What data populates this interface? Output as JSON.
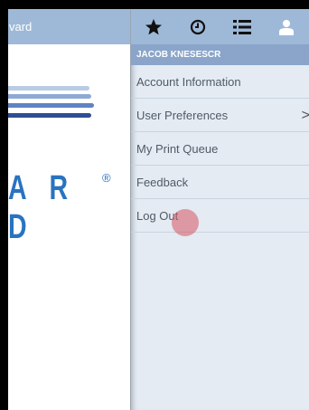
{
  "left_header": {
    "title_fragment": "vard"
  },
  "logo": {
    "text": "A R D",
    "registered": "®"
  },
  "toolbar": {
    "icons": [
      "star-icon",
      "clock-icon",
      "list-icon",
      "user-icon"
    ]
  },
  "user": {
    "name": "JACOB KNESESCR"
  },
  "menu": {
    "items": [
      {
        "label": "Account Information"
      },
      {
        "label": "User Preferences",
        "chevron": ">"
      },
      {
        "label": "My Print Queue"
      },
      {
        "label": "Feedback"
      },
      {
        "label": "Log Out"
      }
    ]
  },
  "colors": {
    "header": "#9eb9d8",
    "user_bar": "#8aa5c9",
    "menu_bg": "#e4ebf3",
    "logo_blue": "#2a73c0",
    "click_marker": "#d65660"
  }
}
